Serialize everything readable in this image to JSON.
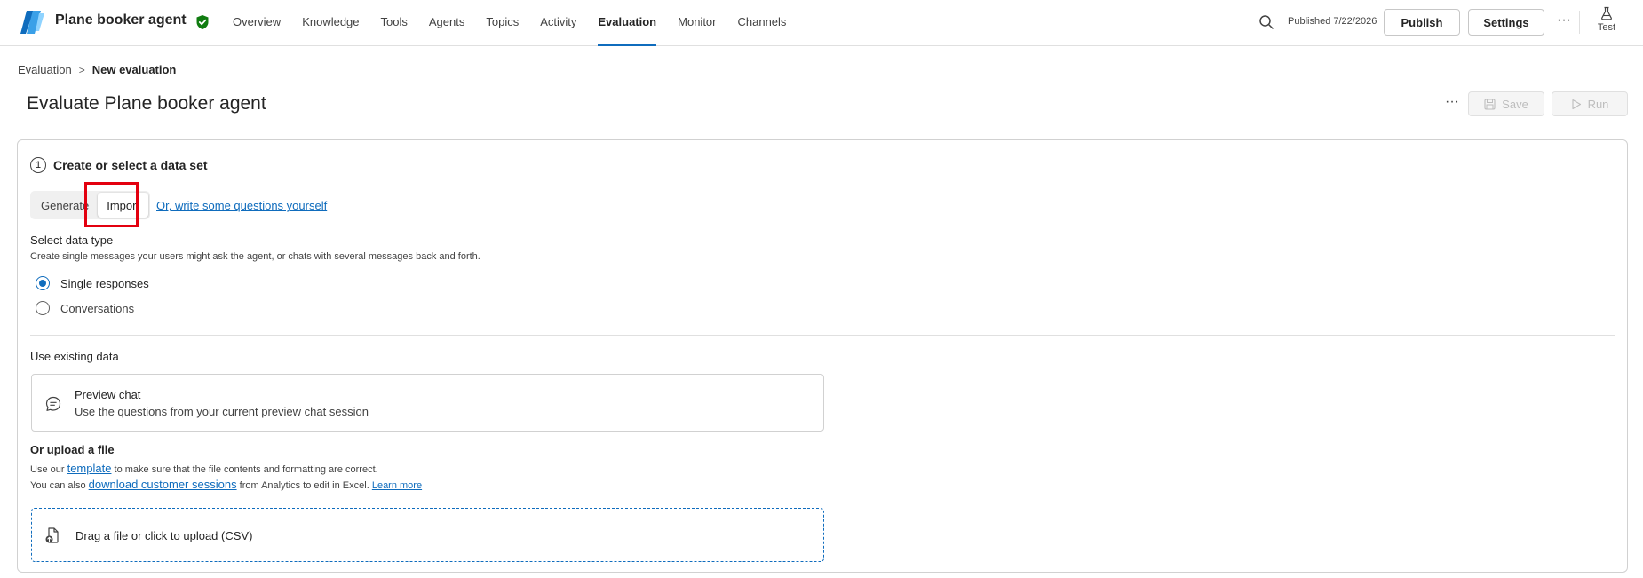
{
  "header": {
    "agent_name": "Plane booker agent",
    "tabs": [
      {
        "label": "Overview"
      },
      {
        "label": "Knowledge"
      },
      {
        "label": "Tools"
      },
      {
        "label": "Agents"
      },
      {
        "label": "Topics"
      },
      {
        "label": "Activity"
      },
      {
        "label": "Evaluation"
      },
      {
        "label": "Monitor"
      },
      {
        "label": "Channels"
      }
    ],
    "active_tab": "Evaluation",
    "published_text": "Published 7/22/2026",
    "publish_label": "Publish",
    "settings_label": "Settings",
    "more_label": "···",
    "test_label": "Test"
  },
  "breadcrumb": {
    "parent": "Evaluation",
    "separator": ">",
    "current": "New evaluation"
  },
  "page": {
    "title": "Evaluate Plane booker agent",
    "more_label": "···",
    "save_label": "Save",
    "run_label": "Run"
  },
  "step": {
    "number": "1",
    "title": "Create or select a data set",
    "segmented": {
      "generate_label": "Generate",
      "import_label": "Import",
      "active": "Import"
    },
    "write_link": "Or, write some questions yourself",
    "data_type": {
      "title": "Select data type",
      "description": "Create single messages your users might ask the agent, or chats with several messages back and forth.",
      "options": [
        {
          "label": "Single responses",
          "checked": true
        },
        {
          "label": "Conversations",
          "checked": false
        }
      ]
    },
    "existing": {
      "title": "Use existing data",
      "preview_title": "Preview chat",
      "preview_desc": "Use the questions from your current preview chat session"
    },
    "upload": {
      "title": "Or upload a file",
      "line1_prefix": "Use our",
      "line1_link": "template",
      "line1_suffix": "to make sure that the file contents and formatting are correct.",
      "line2_prefix": "You can also",
      "line2_link": "download customer sessions",
      "line2_suffix": "from Analytics to edit in Excel.",
      "line2_learn": "Learn more",
      "dropzone_label": "Drag a file or click to upload (CSV)"
    }
  },
  "colors": {
    "accent": "#0f6cbd",
    "highlight": "#e3000f",
    "verified": "#107c10"
  }
}
